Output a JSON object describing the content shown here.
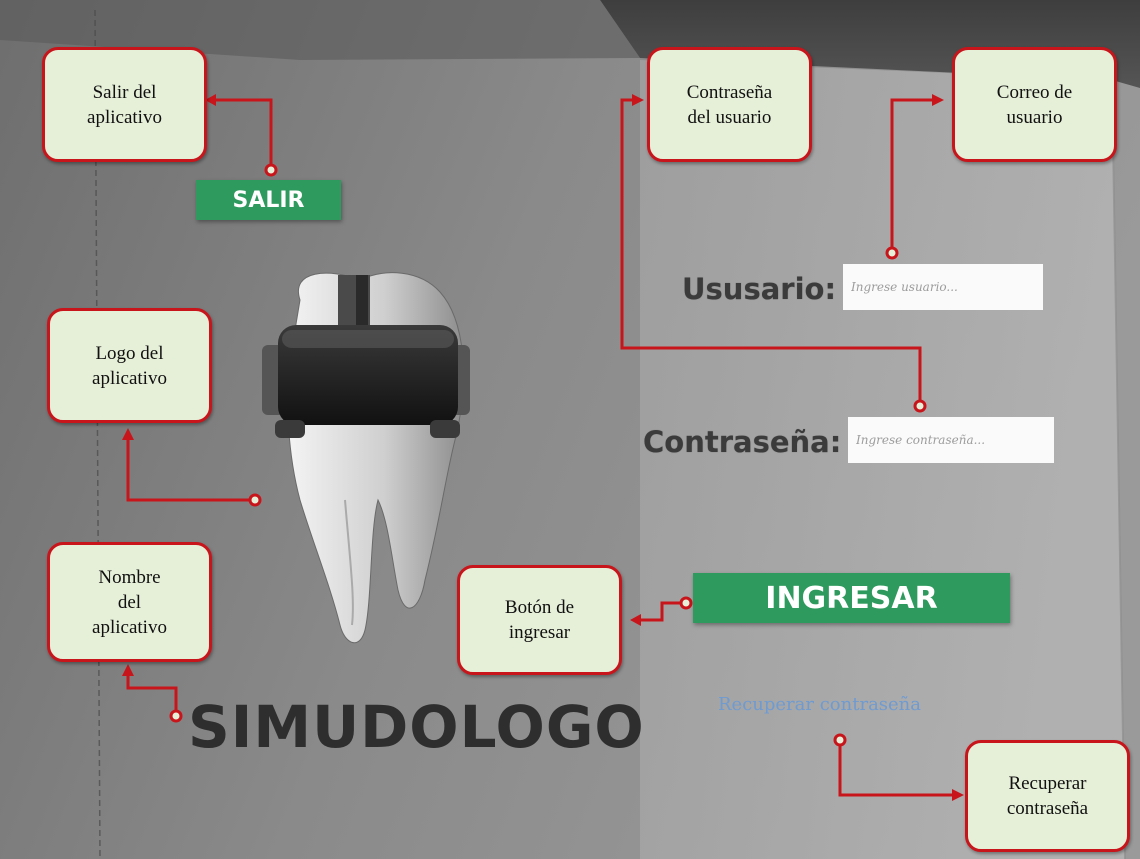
{
  "app": {
    "name": "SIMUDOLOGO",
    "exit_button": "SALIR",
    "login_button": "INGRESAR",
    "recover_link": "Recuperar contraseña"
  },
  "form": {
    "user_label": "Ususario:",
    "user_placeholder": "Ingrese usuario...",
    "password_label": "Contraseña:",
    "password_placeholder": "Ingrese contraseña..."
  },
  "callouts": {
    "exit": "Salir del\naplicativo",
    "password": "Contraseña\ndel usuario",
    "email": "Correo de\nusuario",
    "logo": "Logo del\naplicativo",
    "name": "Nombre\ndel\naplicativo",
    "login": "Botón de\ningresar",
    "recover": "Recuperar\ncontraseña"
  },
  "colors": {
    "annotation": "#c8151b",
    "callout_fill": "#e6f0d8",
    "button_green": "#2f9a5e",
    "link_blue": "#6f9bd1"
  },
  "icons": [
    "tooth-with-vr-headset-logo"
  ]
}
